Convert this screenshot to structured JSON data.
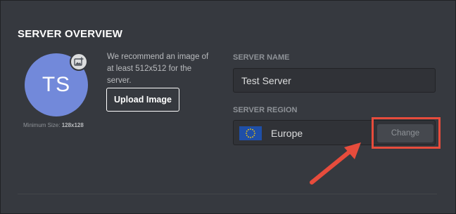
{
  "section": {
    "title": "SERVER OVERVIEW"
  },
  "avatar": {
    "initials": "TS",
    "min_size_label": "Minimum Size:",
    "min_size_value": "128x128",
    "upload_badge_icon": "image-plus-icon"
  },
  "upload": {
    "recommendation": "We recommend an image of at least 512x512 for the server.",
    "button_label": "Upload Image"
  },
  "server_name": {
    "label": "SERVER NAME",
    "value": "Test Server"
  },
  "server_region": {
    "label": "SERVER REGION",
    "region": "Europe",
    "flag_icon": "eu-flag-icon",
    "change_label": "Change"
  },
  "annotation": {
    "highlight_color": "#e74c3c",
    "arrow_icon": "arrow-pointer-icon"
  },
  "colors": {
    "background": "#36393f",
    "avatar": "#7289da",
    "input_bg": "#303237",
    "accent_red": "#e74c3c"
  }
}
